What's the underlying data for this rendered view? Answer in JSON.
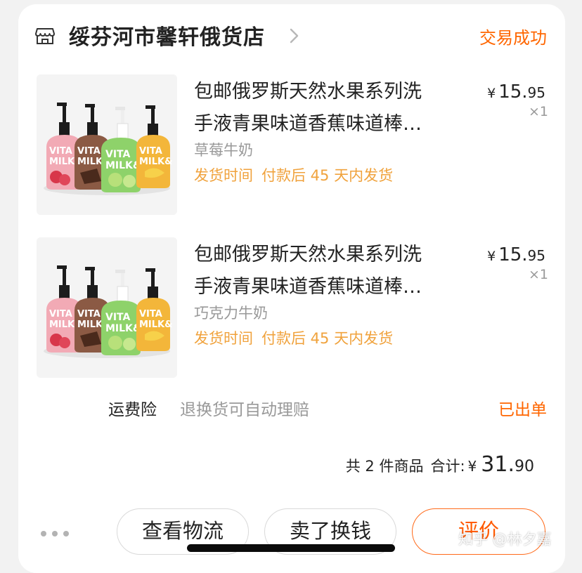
{
  "shop": {
    "name": "绥芬河市馨轩俄货店",
    "status": "交易成功",
    "icon": "store-icon"
  },
  "items": [
    {
      "title_line1": "包邮俄罗斯天然水果系列洗",
      "title_line2": "手液青果味道香蕉味道棒…",
      "variant": "草莓牛奶",
      "ship_label": "发货时间",
      "ship_value": "付款后 45 天内发货",
      "price_symbol": "¥",
      "price_int": "15.",
      "price_dec": "95",
      "qty": "×1",
      "bottles": [
        "VITA",
        "MILK&"
      ]
    },
    {
      "title_line1": "包邮俄罗斯天然水果系列洗",
      "title_line2": "手液青果味道香蕉味道棒…",
      "variant": "巧克力牛奶",
      "ship_label": "发货时间",
      "ship_value": "付款后 45 天内发货",
      "price_symbol": "¥",
      "price_int": "15.",
      "price_dec": "95",
      "qty": "×1",
      "bottles": [
        "VITA",
        "MILK&"
      ]
    }
  ],
  "insurance": {
    "label": "运费险",
    "desc": "退换货可自动理赔",
    "status": "已出单"
  },
  "summary": {
    "count": "共 2 件商品",
    "total_label": "合计:",
    "symbol": "¥",
    "int": "31.",
    "dec": "90"
  },
  "actions": {
    "logistics": "查看物流",
    "resell": "卖了换钱",
    "review": "评价"
  },
  "watermark": "知乎 @林夕嘉",
  "colors": {
    "accent": "#ff6600",
    "ship_time": "#f0a23c",
    "muted": "#999999",
    "background": "#f2f2f2"
  }
}
